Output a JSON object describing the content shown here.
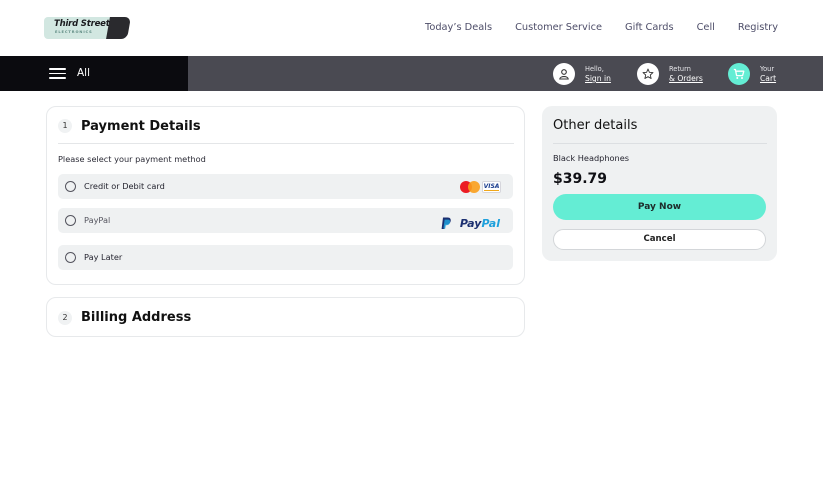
{
  "brand": {
    "name": "Third Street",
    "tagline": "ELECTRONICS"
  },
  "top_nav": {
    "links": [
      "Today’s Deals",
      "Customer Service",
      "Gift Cards",
      "Cell",
      "Registry"
    ]
  },
  "nav_bar": {
    "menu_label": "All",
    "account": {
      "small": "Hello,",
      "big": "Sign in",
      "icon": "user-icon"
    },
    "orders": {
      "small": "Return",
      "big": "& Orders",
      "icon": "star-icon"
    },
    "cart": {
      "small": "Your",
      "big": "Cart",
      "icon": "cart-icon"
    }
  },
  "payment": {
    "step": "1",
    "title": "Payment Details",
    "hint": "Please select your payment method",
    "options": [
      {
        "label": "Credit or Debit card",
        "logos": [
          "mastercard-icon",
          "visa-icon"
        ]
      },
      {
        "label": "PayPal",
        "logos": [
          "paypal-logo"
        ]
      },
      {
        "label": "Pay Later",
        "logos": []
      }
    ],
    "paypal_wordmark_a": "Pay",
    "paypal_wordmark_b": "Pal",
    "visa_text": "VISA"
  },
  "billing": {
    "step": "2",
    "title": "Billing Address"
  },
  "summary": {
    "title": "Other details",
    "product": "Black Headphones",
    "price": "$39.79",
    "pay_label": "Pay Now",
    "cancel_label": "Cancel"
  },
  "colors": {
    "accent": "#64edd4",
    "nav_dark": "#0b0b0f",
    "nav_gray": "#4a4a52",
    "panel_gray": "#eff1f2"
  }
}
